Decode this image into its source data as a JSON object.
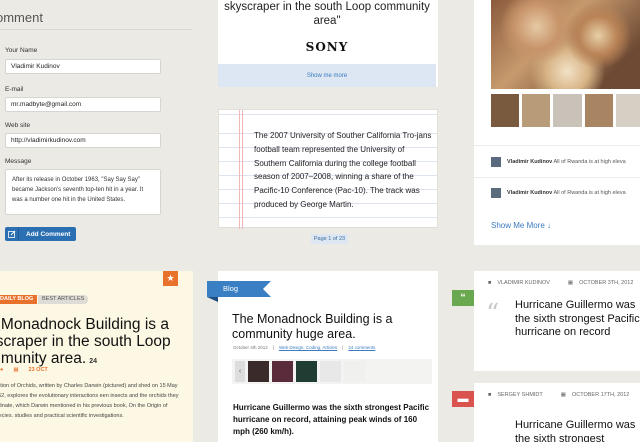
{
  "comment_form": {
    "title": "omment",
    "name_label": "Your Name",
    "name_value": "Vladimir Kudinov",
    "email_label": "E-mail",
    "email_value": "mr.madbyte@gmail.com",
    "website_label": "Web site",
    "website_value": "http://vladimirkudinov.com",
    "message_label": "Message",
    "message_value": "After its release in October 1963, \"Say Say Say\" became Jackson's seventh top-ten hit in a year. It was a number one hit in the United States.",
    "submit_label": "Add Comment"
  },
  "sony_card": {
    "quote": "skyscraper in the south Loop community area\"",
    "logo": "SONY",
    "show_more": "Show me more"
  },
  "notepad_card": {
    "text": "The 2007 University of Souther California Tro-jans football team represented the University of Southern California during the college football season of 2007–2008, winning a share of the Pacific-10 Conference (Pac-10). The track was produced by George Martin.",
    "page_indicator": "Page 1 of 23"
  },
  "photo_card": {
    "posts": [
      {
        "author": "Vladimir Kudinov",
        "text": "All of Rwanda is at high eleva"
      },
      {
        "author": "Vladimir Kudinov",
        "text": "All of Rwanda is at high eleva"
      }
    ],
    "show_more": "Show Me More",
    "thumb_colors": [
      "#7a5a3e",
      "#b89b78",
      "#c9c2b8",
      "#a88462",
      "#d6cfc4"
    ]
  },
  "daily_blog_card": {
    "tag_primary": "DAILY BLOG",
    "tag_secondary": "BEST ARTICLES",
    "title": "e Monadnock Building is a yscraper in the south Loop mmunity area.",
    "comment_count": "24",
    "date": "23 OCT",
    "body": "lisation of Orchids, written by Charles Darwin (pictured) and shed on 15 May 1862, explores the evolutionary interactions een insects and the orchids they pollinate, which Darwin mentioned in his previous book, On the Origin of Species. studies and practical scientific investigations."
  },
  "monadnock_card": {
    "ribbon": "Blog",
    "title": "The Monadnock Building is a community huge area.",
    "meta_date": "October 4th 2012",
    "meta_links": [
      "Web Design, Coding, Articles",
      "24 comments"
    ],
    "body": "Hurricane Guillermo was the sixth strongest Pacific hurricane on record, attaining peak winds of 160 mph (260 km/h).",
    "gallery_colors": [
      "#3b2a2a",
      "#5a2b3a",
      "#1f3d33",
      "#e8e8e8",
      "#f0f0ee"
    ]
  },
  "quote_cards": [
    {
      "author": "VLADIMIR KUDINOV",
      "date": "OCTOBER 3TH, 2012",
      "quote": "Hurricane Guillermo was the sixth strongest Pacific hurricane on record",
      "tab_color": "#6aa84f"
    },
    {
      "author": "SERGEY SHMIDT",
      "date": "OCTOBER 17TH, 2012",
      "quote": "Hurricane Guillermo was the sixth strongest",
      "tab_color": "#d9534f"
    }
  ],
  "colors": {
    "background": "#ebeae4",
    "accent_blue": "#2b6fb3",
    "accent_orange": "#e8712b"
  }
}
